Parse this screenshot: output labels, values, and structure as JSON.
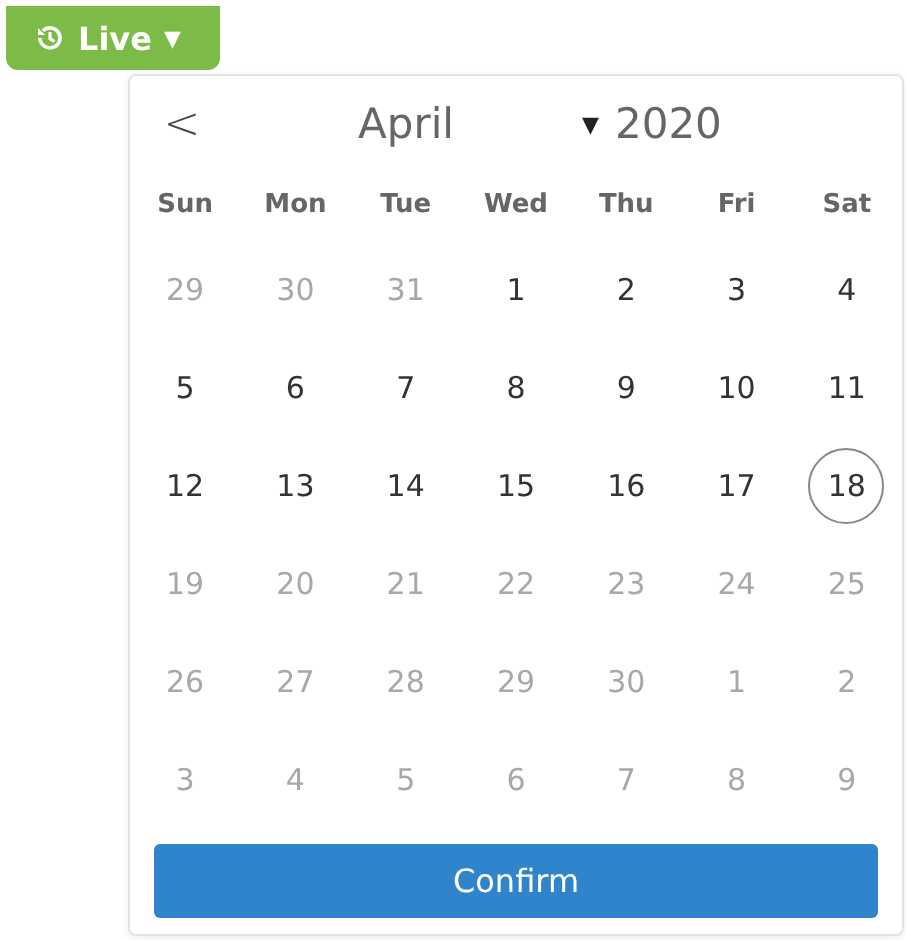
{
  "live_button": {
    "label": "Live",
    "caret": "▼"
  },
  "calendar": {
    "prev": "<",
    "month": "April",
    "month_caret": "▼",
    "year": "2020",
    "weekdays": [
      "Sun",
      "Mon",
      "Tue",
      "Wed",
      "Thu",
      "Fri",
      "Sat"
    ],
    "days": [
      {
        "label": "29",
        "disabled": true,
        "selected": false
      },
      {
        "label": "30",
        "disabled": true,
        "selected": false
      },
      {
        "label": "31",
        "disabled": true,
        "selected": false
      },
      {
        "label": "1",
        "disabled": false,
        "selected": false
      },
      {
        "label": "2",
        "disabled": false,
        "selected": false
      },
      {
        "label": "3",
        "disabled": false,
        "selected": false
      },
      {
        "label": "4",
        "disabled": false,
        "selected": false
      },
      {
        "label": "5",
        "disabled": false,
        "selected": false
      },
      {
        "label": "6",
        "disabled": false,
        "selected": false
      },
      {
        "label": "7",
        "disabled": false,
        "selected": false
      },
      {
        "label": "8",
        "disabled": false,
        "selected": false
      },
      {
        "label": "9",
        "disabled": false,
        "selected": false
      },
      {
        "label": "10",
        "disabled": false,
        "selected": false
      },
      {
        "label": "11",
        "disabled": false,
        "selected": false
      },
      {
        "label": "12",
        "disabled": false,
        "selected": false
      },
      {
        "label": "13",
        "disabled": false,
        "selected": false
      },
      {
        "label": "14",
        "disabled": false,
        "selected": false
      },
      {
        "label": "15",
        "disabled": false,
        "selected": false
      },
      {
        "label": "16",
        "disabled": false,
        "selected": false
      },
      {
        "label": "17",
        "disabled": false,
        "selected": false
      },
      {
        "label": "18",
        "disabled": false,
        "selected": true
      },
      {
        "label": "19",
        "disabled": true,
        "selected": false
      },
      {
        "label": "20",
        "disabled": true,
        "selected": false
      },
      {
        "label": "21",
        "disabled": true,
        "selected": false
      },
      {
        "label": "22",
        "disabled": true,
        "selected": false
      },
      {
        "label": "23",
        "disabled": true,
        "selected": false
      },
      {
        "label": "24",
        "disabled": true,
        "selected": false
      },
      {
        "label": "25",
        "disabled": true,
        "selected": false
      },
      {
        "label": "26",
        "disabled": true,
        "selected": false
      },
      {
        "label": "27",
        "disabled": true,
        "selected": false
      },
      {
        "label": "28",
        "disabled": true,
        "selected": false
      },
      {
        "label": "29",
        "disabled": true,
        "selected": false
      },
      {
        "label": "30",
        "disabled": true,
        "selected": false
      },
      {
        "label": "1",
        "disabled": true,
        "selected": false
      },
      {
        "label": "2",
        "disabled": true,
        "selected": false
      },
      {
        "label": "3",
        "disabled": true,
        "selected": false
      },
      {
        "label": "4",
        "disabled": true,
        "selected": false
      },
      {
        "label": "5",
        "disabled": true,
        "selected": false
      },
      {
        "label": "6",
        "disabled": true,
        "selected": false
      },
      {
        "label": "7",
        "disabled": true,
        "selected": false
      },
      {
        "label": "8",
        "disabled": true,
        "selected": false
      },
      {
        "label": "9",
        "disabled": true,
        "selected": false
      }
    ],
    "confirm": "Confirm"
  }
}
